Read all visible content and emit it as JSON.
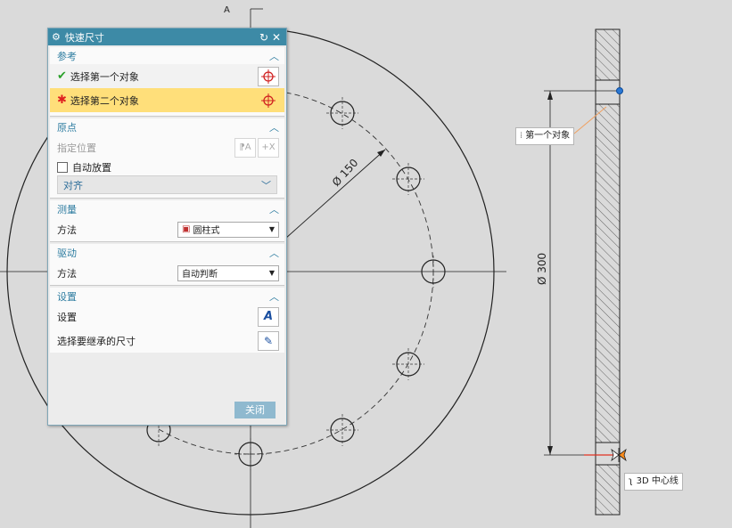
{
  "dialog": {
    "title": "快速尺寸",
    "reset_icon": "reset-icon",
    "close_icon": "close-icon",
    "sections": {
      "reference": {
        "header": "参考",
        "first_object": "选择第一个对象",
        "second_object": "选择第二个对象"
      },
      "origin": {
        "header": "原点",
        "specify_location": "指定位置",
        "auto_place": "自动放置",
        "align": "对齐"
      },
      "measure": {
        "header": "测量",
        "method_label": "方法",
        "method_value": "圆柱式"
      },
      "drive": {
        "header": "驱动",
        "method_label": "方法",
        "method_value": "自动判断"
      },
      "settings": {
        "header": "设置",
        "settings_label": "设置",
        "inherit_label": "选择要继承的尺寸"
      }
    },
    "close_button": "关闭"
  },
  "drawing": {
    "dim_bolt_circle": "Ø 150",
    "dim_diameter": "Ø 300",
    "tooltip_first_object": "第一个对象",
    "tooltip_centerline": "3D 中心线",
    "section_letter": "A"
  },
  "colors": {
    "title_bar": "#3d8aa6",
    "highlight_row": "#ffdf7a",
    "section_header": "#2d7ca0",
    "check_green": "#2aa02a",
    "asterisk_red": "#e02020",
    "close_button": "#8fb9cf"
  }
}
